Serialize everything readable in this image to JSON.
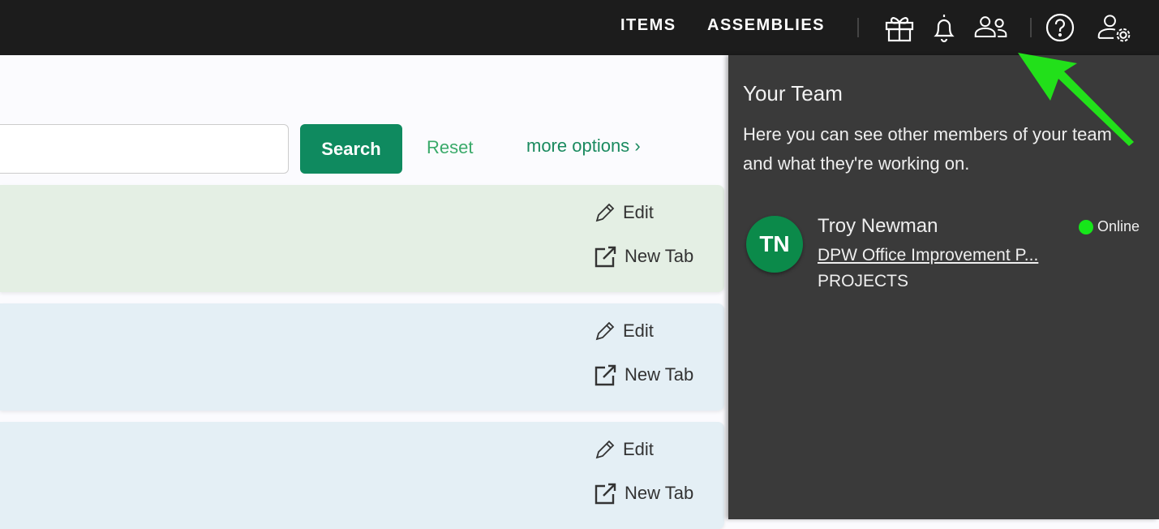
{
  "topbar": {
    "nav": [
      {
        "label": "ITEMS"
      },
      {
        "label": "ASSEMBLIES"
      }
    ],
    "icons": [
      "gift-icon",
      "bell-icon",
      "team-icon",
      "help-icon",
      "user-settings-icon"
    ]
  },
  "search": {
    "button_label": "Search",
    "reset_label": "Reset",
    "more_label": "more options",
    "more_icon": "chevron-right-icon",
    "value": ""
  },
  "cards": [
    {
      "color": "#e4efe4",
      "edit": "Edit",
      "new_tab": "New Tab"
    },
    {
      "color": "#e4eff5",
      "edit": "Edit",
      "new_tab": "New Tab"
    },
    {
      "color": "#e4eff5",
      "edit": "Edit",
      "new_tab": "New Tab"
    }
  ],
  "team_panel": {
    "title": "Your Team",
    "description": "Here you can see other members of your team and what they're working on.",
    "members": [
      {
        "initials": "TN",
        "name": "Troy Newman",
        "project": "DPW Office Improvement P...",
        "type": "PROJECTS",
        "status": "Online",
        "status_color": "#16e61a",
        "avatar_color": "#0b8a4a"
      }
    ]
  },
  "annotation": {
    "arrow_color": "#22e01a"
  }
}
